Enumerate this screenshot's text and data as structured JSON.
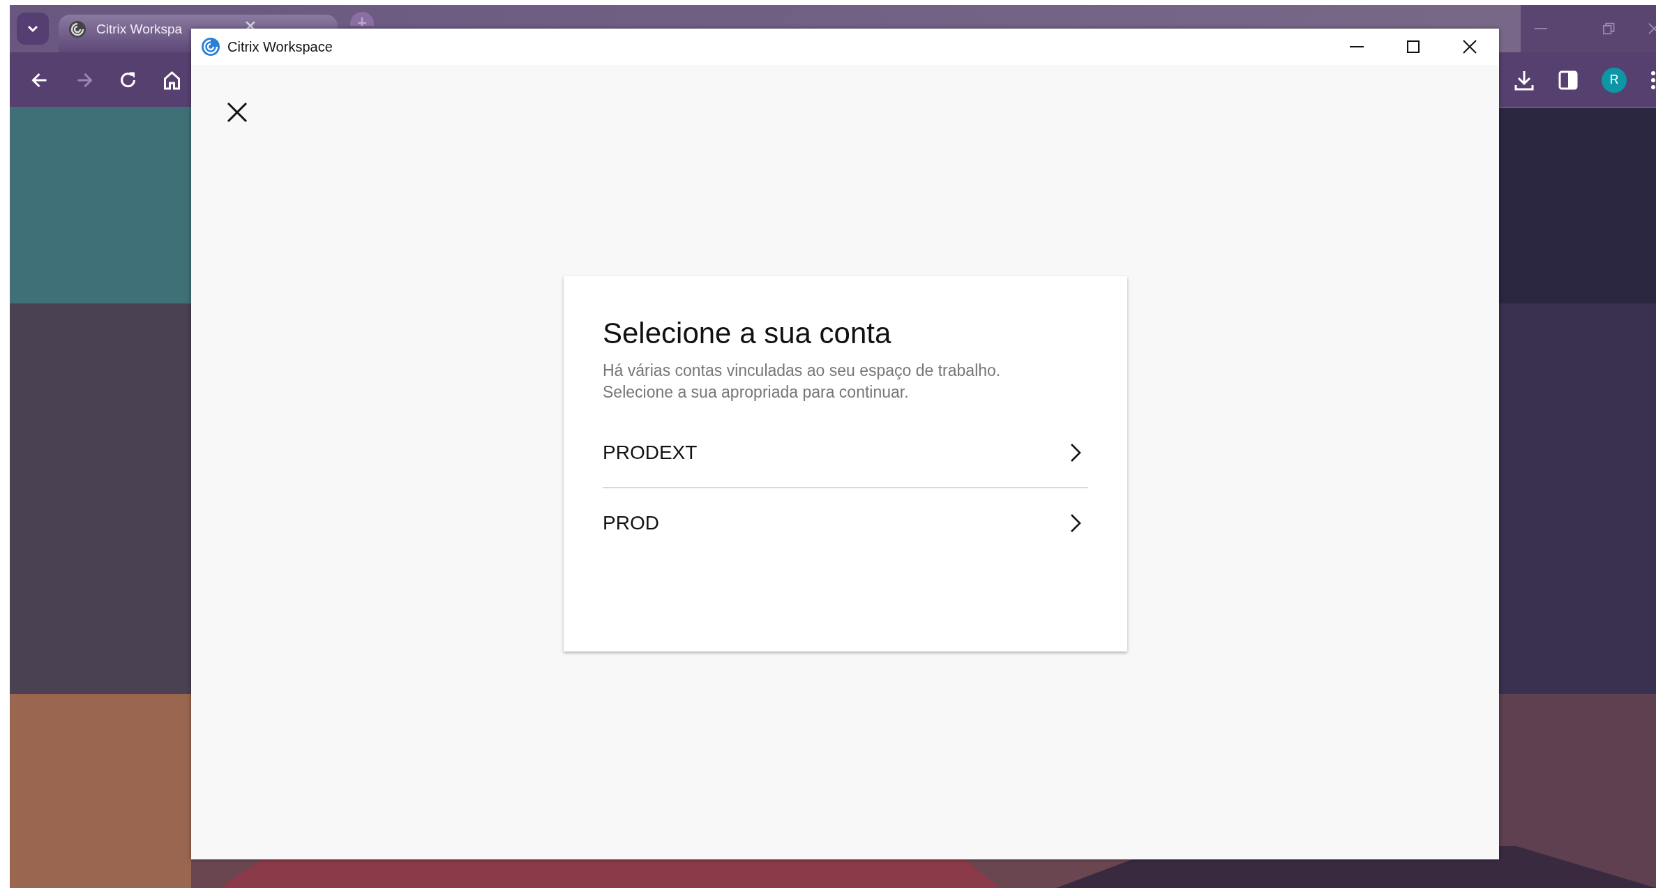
{
  "browser": {
    "tab": {
      "title": "Citrix Workspa"
    },
    "nav": [
      {
        "kind": "back",
        "disabled": false
      },
      {
        "kind": "forward",
        "disabled": true
      },
      {
        "kind": "reload",
        "disabled": false
      },
      {
        "kind": "home",
        "disabled": false
      }
    ],
    "profile": {
      "initial": "R"
    }
  },
  "window": {
    "title": "Citrix Workspace"
  },
  "dialog": {
    "title": "Selecione a sua conta",
    "description": "Há várias contas vinculadas ao seu espaço de trabalho. Selecione a sua apropriada para continuar.",
    "accounts": [
      {
        "name": "PRODEXT"
      },
      {
        "name": "PROD"
      }
    ]
  }
}
